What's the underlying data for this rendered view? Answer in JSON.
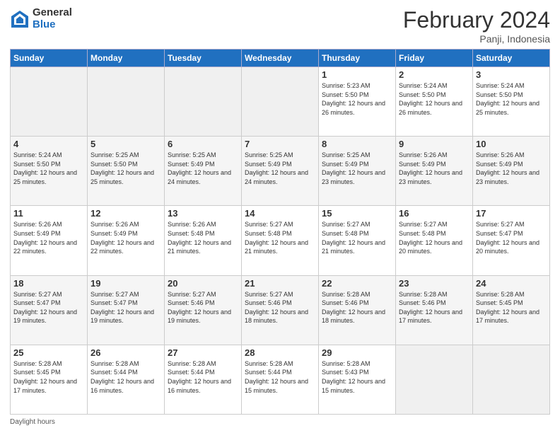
{
  "header": {
    "logo_general": "General",
    "logo_blue": "Blue",
    "title": "February 2024",
    "subtitle": "Panji, Indonesia"
  },
  "days_of_week": [
    "Sunday",
    "Monday",
    "Tuesday",
    "Wednesday",
    "Thursday",
    "Friday",
    "Saturday"
  ],
  "weeks": [
    [
      {
        "day": "",
        "detail": ""
      },
      {
        "day": "",
        "detail": ""
      },
      {
        "day": "",
        "detail": ""
      },
      {
        "day": "",
        "detail": ""
      },
      {
        "day": "1",
        "detail": "Sunrise: 5:23 AM\nSunset: 5:50 PM\nDaylight: 12 hours\nand 26 minutes."
      },
      {
        "day": "2",
        "detail": "Sunrise: 5:24 AM\nSunset: 5:50 PM\nDaylight: 12 hours\nand 26 minutes."
      },
      {
        "day": "3",
        "detail": "Sunrise: 5:24 AM\nSunset: 5:50 PM\nDaylight: 12 hours\nand 25 minutes."
      }
    ],
    [
      {
        "day": "4",
        "detail": "Sunrise: 5:24 AM\nSunset: 5:50 PM\nDaylight: 12 hours\nand 25 minutes."
      },
      {
        "day": "5",
        "detail": "Sunrise: 5:25 AM\nSunset: 5:50 PM\nDaylight: 12 hours\nand 25 minutes."
      },
      {
        "day": "6",
        "detail": "Sunrise: 5:25 AM\nSunset: 5:49 PM\nDaylight: 12 hours\nand 24 minutes."
      },
      {
        "day": "7",
        "detail": "Sunrise: 5:25 AM\nSunset: 5:49 PM\nDaylight: 12 hours\nand 24 minutes."
      },
      {
        "day": "8",
        "detail": "Sunrise: 5:25 AM\nSunset: 5:49 PM\nDaylight: 12 hours\nand 23 minutes."
      },
      {
        "day": "9",
        "detail": "Sunrise: 5:26 AM\nSunset: 5:49 PM\nDaylight: 12 hours\nand 23 minutes."
      },
      {
        "day": "10",
        "detail": "Sunrise: 5:26 AM\nSunset: 5:49 PM\nDaylight: 12 hours\nand 23 minutes."
      }
    ],
    [
      {
        "day": "11",
        "detail": "Sunrise: 5:26 AM\nSunset: 5:49 PM\nDaylight: 12 hours\nand 22 minutes."
      },
      {
        "day": "12",
        "detail": "Sunrise: 5:26 AM\nSunset: 5:49 PM\nDaylight: 12 hours\nand 22 minutes."
      },
      {
        "day": "13",
        "detail": "Sunrise: 5:26 AM\nSunset: 5:48 PM\nDaylight: 12 hours\nand 21 minutes."
      },
      {
        "day": "14",
        "detail": "Sunrise: 5:27 AM\nSunset: 5:48 PM\nDaylight: 12 hours\nand 21 minutes."
      },
      {
        "day": "15",
        "detail": "Sunrise: 5:27 AM\nSunset: 5:48 PM\nDaylight: 12 hours\nand 21 minutes."
      },
      {
        "day": "16",
        "detail": "Sunrise: 5:27 AM\nSunset: 5:48 PM\nDaylight: 12 hours\nand 20 minutes."
      },
      {
        "day": "17",
        "detail": "Sunrise: 5:27 AM\nSunset: 5:47 PM\nDaylight: 12 hours\nand 20 minutes."
      }
    ],
    [
      {
        "day": "18",
        "detail": "Sunrise: 5:27 AM\nSunset: 5:47 PM\nDaylight: 12 hours\nand 19 minutes."
      },
      {
        "day": "19",
        "detail": "Sunrise: 5:27 AM\nSunset: 5:47 PM\nDaylight: 12 hours\nand 19 minutes."
      },
      {
        "day": "20",
        "detail": "Sunrise: 5:27 AM\nSunset: 5:46 PM\nDaylight: 12 hours\nand 19 minutes."
      },
      {
        "day": "21",
        "detail": "Sunrise: 5:27 AM\nSunset: 5:46 PM\nDaylight: 12 hours\nand 18 minutes."
      },
      {
        "day": "22",
        "detail": "Sunrise: 5:28 AM\nSunset: 5:46 PM\nDaylight: 12 hours\nand 18 minutes."
      },
      {
        "day": "23",
        "detail": "Sunrise: 5:28 AM\nSunset: 5:46 PM\nDaylight: 12 hours\nand 17 minutes."
      },
      {
        "day": "24",
        "detail": "Sunrise: 5:28 AM\nSunset: 5:45 PM\nDaylight: 12 hours\nand 17 minutes."
      }
    ],
    [
      {
        "day": "25",
        "detail": "Sunrise: 5:28 AM\nSunset: 5:45 PM\nDaylight: 12 hours\nand 17 minutes."
      },
      {
        "day": "26",
        "detail": "Sunrise: 5:28 AM\nSunset: 5:44 PM\nDaylight: 12 hours\nand 16 minutes."
      },
      {
        "day": "27",
        "detail": "Sunrise: 5:28 AM\nSunset: 5:44 PM\nDaylight: 12 hours\nand 16 minutes."
      },
      {
        "day": "28",
        "detail": "Sunrise: 5:28 AM\nSunset: 5:44 PM\nDaylight: 12 hours\nand 15 minutes."
      },
      {
        "day": "29",
        "detail": "Sunrise: 5:28 AM\nSunset: 5:43 PM\nDaylight: 12 hours\nand 15 minutes."
      },
      {
        "day": "",
        "detail": ""
      },
      {
        "day": "",
        "detail": ""
      }
    ]
  ],
  "footer": {
    "daylight_label": "Daylight hours"
  }
}
